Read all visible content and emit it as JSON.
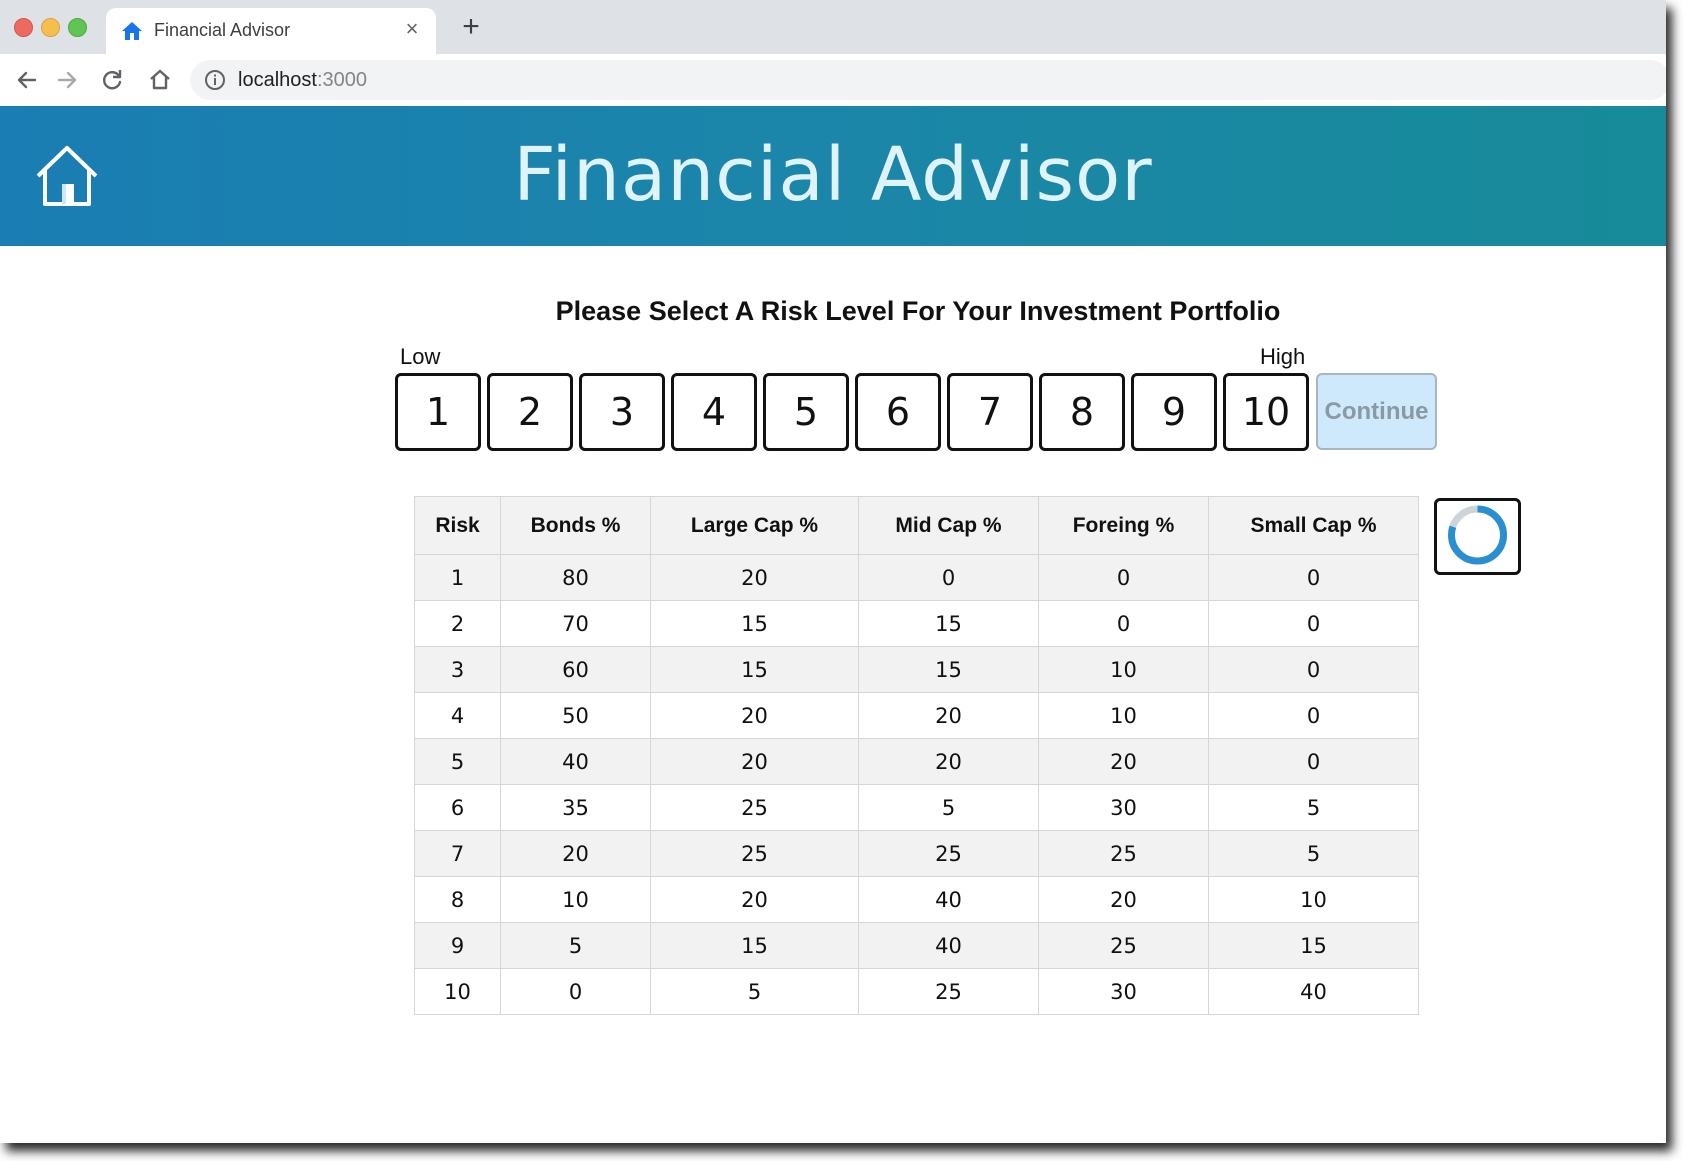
{
  "browser": {
    "tab": {
      "title": "Financial Advisor",
      "close_glyph": "×",
      "icon": "home-icon"
    },
    "new_tab_glyph": "+",
    "url": {
      "host": "localhost",
      "port": ":3000"
    }
  },
  "header": {
    "title": "Financial Advisor",
    "home_icon": "home-icon",
    "gradient_colors": [
      "#1a7db3",
      "#178b99"
    ]
  },
  "risk_selector": {
    "prompt": "Please Select A Risk Level For Your Investment Portfolio",
    "low_label": "Low",
    "high_label": "High",
    "levels": [
      "1",
      "2",
      "3",
      "4",
      "5",
      "6",
      "7",
      "8",
      "9",
      "10"
    ],
    "continue_label": "Continue",
    "continue_enabled": false
  },
  "table": {
    "headers": [
      "Risk",
      "Bonds %",
      "Large Cap %",
      "Mid Cap %",
      "Foreing %",
      "Small Cap %"
    ],
    "rows": [
      [
        "1",
        "80",
        "20",
        "0",
        "0",
        "0"
      ],
      [
        "2",
        "70",
        "15",
        "15",
        "0",
        "0"
      ],
      [
        "3",
        "60",
        "15",
        "15",
        "10",
        "0"
      ],
      [
        "4",
        "50",
        "20",
        "20",
        "10",
        "0"
      ],
      [
        "5",
        "40",
        "20",
        "20",
        "20",
        "0"
      ],
      [
        "6",
        "35",
        "25",
        "5",
        "30",
        "5"
      ],
      [
        "7",
        "20",
        "25",
        "25",
        "25",
        "5"
      ],
      [
        "8",
        "10",
        "20",
        "40",
        "20",
        "10"
      ],
      [
        "9",
        "5",
        "15",
        "40",
        "25",
        "15"
      ],
      [
        "10",
        "0",
        "5",
        "25",
        "30",
        "40"
      ]
    ]
  },
  "chart_thumbnail": {
    "type": "donut",
    "filled_fraction": 0.8,
    "fill_color": "#2a8fd0",
    "track_color": "#cfd4d8"
  }
}
